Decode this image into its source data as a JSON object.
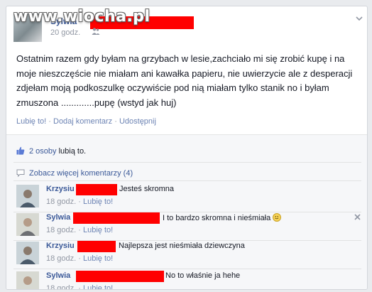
{
  "watermark": "www.wiocha.pl",
  "post": {
    "author": "Sylwia",
    "time": "20 godz.",
    "text": "Ostatnim razem gdy byłam na grzybach w lesie,zachciało mi się zrobić kupę i na moje nieszczęście nie miałam ani kawałka papieru, nie uwierzycie ale z desperacji zdjełam moją podkoszulkę oczywiście pod nią miałam tylko stanik no i byłam zmuszona .............pupę (wstyd jak huj)",
    "actions": [
      "Lubię to!",
      "Dodaj komentarz",
      "Udostępnij"
    ]
  },
  "likes": {
    "count_text": "2 osoby",
    "suffix": " lubią to."
  },
  "more_comments": "Zobacz więcej komentarzy (4)",
  "comments": [
    {
      "name": "Krzysiu",
      "text": "Jesteś skromna",
      "time": "18 godz.",
      "like": "Lubię to!"
    },
    {
      "name": "Sylwia",
      "text": "I to bardzo skromna i nieśmiała",
      "time": "18 godz.",
      "like": "Lubię to!"
    },
    {
      "name": "Krzysiu",
      "text": "Najlepsza jest nieśmiała dziewczyna",
      "time": "18 godz.",
      "like": "Lubię to!"
    },
    {
      "name": "Sylwia",
      "text": "No to właśnie ja hehe",
      "time": "18 godz.",
      "like": "Lubię to!"
    }
  ],
  "colors": {
    "link": "#3b5998",
    "redaction": "#ff0000",
    "background": "#e9ebee"
  }
}
